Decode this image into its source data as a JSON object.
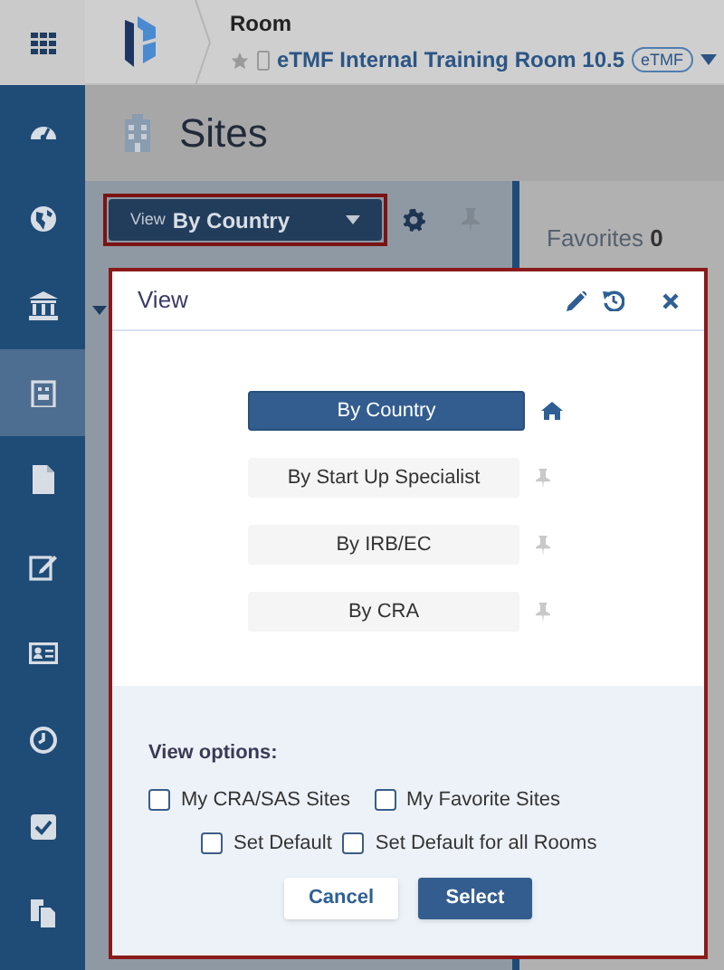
{
  "sidebar": {
    "items": [
      {
        "kind": "dashboard",
        "selected": false
      },
      {
        "kind": "globe",
        "selected": false
      },
      {
        "kind": "bank",
        "selected": false
      },
      {
        "kind": "building",
        "selected": true
      },
      {
        "kind": "file",
        "selected": false
      },
      {
        "kind": "edit",
        "selected": false
      },
      {
        "kind": "card",
        "selected": false
      },
      {
        "kind": "clock",
        "selected": false
      },
      {
        "kind": "check",
        "selected": false
      },
      {
        "kind": "copy",
        "selected": false
      }
    ]
  },
  "header": {
    "section": "Room",
    "room_name": "eTMF Internal Training Room 10.5",
    "badge": "eTMF"
  },
  "page_title": "Sites",
  "view_button": {
    "prefix": "View",
    "value": "By Country"
  },
  "favorites": {
    "label": "Favorites",
    "count": "0"
  },
  "dialog": {
    "title": "View",
    "views": [
      {
        "label": "By Country",
        "selected": true
      },
      {
        "label": "By Start Up Specialist",
        "selected": false
      },
      {
        "label": "By IRB/EC",
        "selected": false
      },
      {
        "label": "By CRA",
        "selected": false
      }
    ],
    "options_label": "View options:",
    "options": [
      {
        "label": "My CRA/SAS Sites",
        "checked": false
      },
      {
        "label": "My Favorite Sites",
        "checked": false
      },
      {
        "label": "Set Default",
        "checked": false
      },
      {
        "label": "Set Default for all Rooms",
        "checked": false
      }
    ],
    "buttons": [
      {
        "label": "Cancel",
        "kind": "secondary"
      },
      {
        "label": "Select",
        "kind": "primary"
      }
    ]
  }
}
